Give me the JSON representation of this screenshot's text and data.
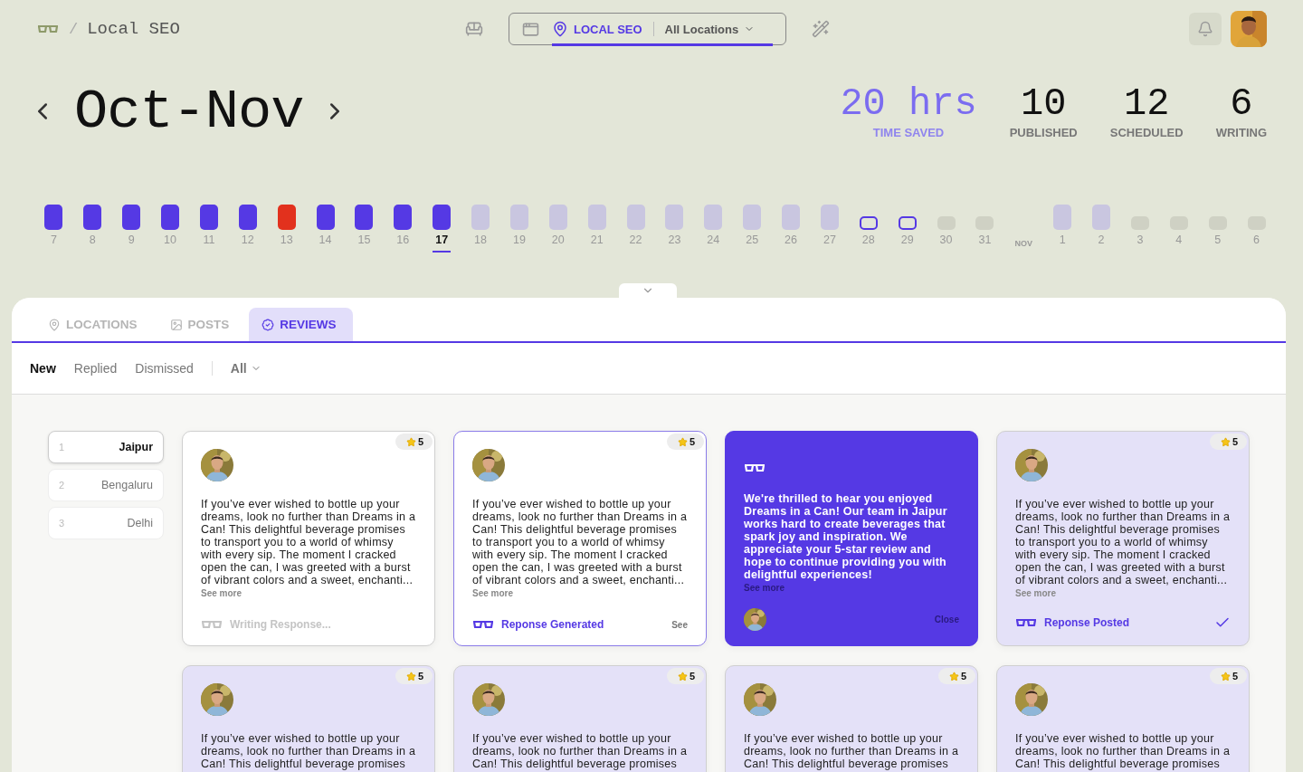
{
  "breadcrumb": {
    "separator": "/",
    "title": "Local SEO"
  },
  "switcher": {
    "label": "LOCAL SEO",
    "location": "All Locations"
  },
  "period": {
    "title": "Oct-Nov"
  },
  "stats": [
    {
      "value": "20 hrs",
      "label": "TIME SAVED",
      "kind": "accent"
    },
    {
      "value": "10",
      "label": "PUBLISHED",
      "kind": "plain"
    },
    {
      "value": "12",
      "label": "SCHEDULED",
      "kind": "plain"
    },
    {
      "value": "6",
      "label": "WRITING",
      "kind": "plain"
    }
  ],
  "days": [
    {
      "label": "7",
      "kind": "done",
      "selected": false
    },
    {
      "label": "8",
      "kind": "done",
      "selected": false
    },
    {
      "label": "9",
      "kind": "done",
      "selected": false
    },
    {
      "label": "10",
      "kind": "done",
      "selected": false
    },
    {
      "label": "11",
      "kind": "done",
      "selected": false
    },
    {
      "label": "12",
      "kind": "done",
      "selected": false
    },
    {
      "label": "13",
      "kind": "failed",
      "selected": false
    },
    {
      "label": "14",
      "kind": "done",
      "selected": false
    },
    {
      "label": "15",
      "kind": "done",
      "selected": false
    },
    {
      "label": "16",
      "kind": "done",
      "selected": false
    },
    {
      "label": "17",
      "kind": "done",
      "selected": true
    },
    {
      "label": "18",
      "kind": "planned",
      "selected": false
    },
    {
      "label": "19",
      "kind": "planned",
      "selected": false
    },
    {
      "label": "20",
      "kind": "planned",
      "selected": false
    },
    {
      "label": "21",
      "kind": "planned",
      "selected": false
    },
    {
      "label": "22",
      "kind": "planned",
      "selected": false
    },
    {
      "label": "23",
      "kind": "planned",
      "selected": false
    },
    {
      "label": "24",
      "kind": "planned",
      "selected": false
    },
    {
      "label": "25",
      "kind": "planned",
      "selected": false
    },
    {
      "label": "26",
      "kind": "planned",
      "selected": false
    },
    {
      "label": "27",
      "kind": "planned",
      "selected": false
    },
    {
      "label": "28",
      "kind": "draft",
      "selected": false
    },
    {
      "label": "29",
      "kind": "draft",
      "selected": false
    },
    {
      "label": "30",
      "kind": "empty",
      "selected": false
    },
    {
      "label": "31",
      "kind": "empty",
      "selected": false
    },
    {
      "label": "NOV",
      "kind": "month"
    },
    {
      "label": "1",
      "kind": "planned",
      "selected": false
    },
    {
      "label": "2",
      "kind": "planned",
      "selected": false
    },
    {
      "label": "3",
      "kind": "empty",
      "selected": false
    },
    {
      "label": "4",
      "kind": "empty",
      "selected": false
    },
    {
      "label": "5",
      "kind": "empty",
      "selected": false
    },
    {
      "label": "6",
      "kind": "empty",
      "selected": false
    }
  ],
  "tabs": [
    {
      "label": "LOCATIONS",
      "selected": false
    },
    {
      "label": "POSTS",
      "selected": false
    },
    {
      "label": "REVIEWS",
      "selected": true
    }
  ],
  "filters": [
    {
      "label": "New",
      "selected": true
    },
    {
      "label": "Replied",
      "selected": false
    },
    {
      "label": "Dismissed",
      "selected": false
    }
  ],
  "filter_dropdown": "All",
  "locations": [
    {
      "index": "1",
      "name": "Jaipur",
      "selected": true
    },
    {
      "index": "2",
      "name": "Bengaluru",
      "selected": false
    },
    {
      "index": "3",
      "name": "Delhi",
      "selected": false
    }
  ],
  "reviews": [
    {
      "kind": "writing",
      "rating": "5",
      "text": "If you’ve ever wished to bottle up your dreams, look no further than Dreams in a Can! This delightful beverage promises to transport you to a world of whimsy with every sip. The moment I cracked open the can, I was greeted with a burst of vibrant colors and a sweet, enchanti...",
      "more": "See more",
      "status": "Writing Response...",
      "selected": false
    },
    {
      "kind": "generated",
      "rating": "5",
      "text": "If you’ve ever wished to bottle up your dreams, look no further than Dreams in a Can! This delightful beverage promises to transport you to a world of whimsy with every sip. The moment I cracked open the can, I was greeted with a burst of vibrant colors and a sweet, enchanti...",
      "more": "See more",
      "status": "Reponse Generated",
      "action": "See",
      "selected": true
    },
    {
      "kind": "response",
      "text": "We're thrilled to hear you enjoyed Dreams in a Can! Our team in Jaipur works hard to create beverages that spark joy and inspiration. We appreciate your 5-star review and hope to continue providing you with delightful experiences!",
      "more": "See more",
      "action": "Close",
      "selected": false
    },
    {
      "kind": "posted",
      "rating": "5",
      "text": "If you’ve ever wished to bottle up your dreams, look no further than Dreams in a Can! This delightful beverage promises to transport you to a world of whimsy with every sip. The moment I cracked open the can, I was greeted with a burst of vibrant colors and a sweet, enchanti...",
      "more": "See more",
      "status": "Reponse Posted",
      "selected": false
    },
    {
      "kind": "preview",
      "rating": "5",
      "text": "If you’ve ever wished to bottle up your dreams, look no further than Dreams in a Can! This delightful beverage promises",
      "selected": false
    },
    {
      "kind": "preview",
      "rating": "5",
      "text": "If you’ve ever wished to bottle up your dreams, look no further than Dreams in a Can! This delightful beverage promises",
      "selected": false
    },
    {
      "kind": "preview",
      "rating": "5",
      "text": "If you’ve ever wished to bottle up your dreams, look no further than Dreams in a Can! This delightful beverage promises",
      "selected": false
    },
    {
      "kind": "preview",
      "rating": "5",
      "text": "If you’ve ever wished to bottle up your dreams, look no further than Dreams in a Can! This delightful beverage promises",
      "selected": false
    }
  ]
}
